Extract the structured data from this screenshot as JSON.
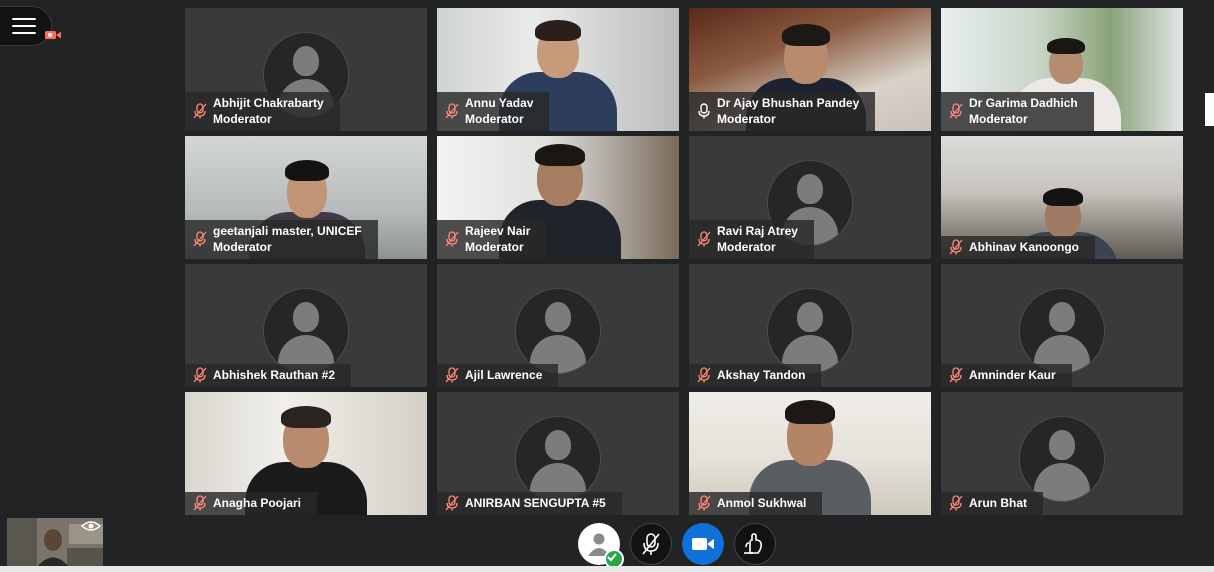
{
  "app": {
    "accent": "#0f70d7",
    "active_speaker_border": "#e8857c"
  },
  "participants": [
    {
      "name": "Abhijit Chakrabarty",
      "role": "Moderator",
      "video": false,
      "mic": "muted"
    },
    {
      "name": "Annu Yadav",
      "role": "Moderator",
      "video": true,
      "mic": "muted"
    },
    {
      "name": "Dr Ajay Bhushan Pandey",
      "role": "Moderator",
      "video": true,
      "mic": "talking",
      "active": true
    },
    {
      "name": "Dr Garima Dadhich",
      "role": "Moderator",
      "video": true,
      "mic": "muted"
    },
    {
      "name": "geetanjali master, UNICEF",
      "role": "Moderator",
      "video": true,
      "mic": "muted"
    },
    {
      "name": "Rajeev Nair",
      "role": "Moderator",
      "video": true,
      "mic": "muted"
    },
    {
      "name": "Ravi Raj Atrey",
      "role": "Moderator",
      "video": false,
      "mic": "muted"
    },
    {
      "name": "Abhinav Kanoongo",
      "role": "",
      "video": true,
      "mic": "muted"
    },
    {
      "name": "Abhishek Rauthan #2",
      "role": "",
      "video": false,
      "mic": "muted"
    },
    {
      "name": "Ajil Lawrence",
      "role": "",
      "video": false,
      "mic": "muted"
    },
    {
      "name": "Akshay Tandon",
      "role": "",
      "video": false,
      "mic": "muted"
    },
    {
      "name": "Amninder Kaur",
      "role": "",
      "video": false,
      "mic": "muted"
    },
    {
      "name": "Anagha Poojari",
      "role": "",
      "video": true,
      "mic": "muted"
    },
    {
      "name": "ANIRBAN SENGUPTA #5",
      "role": "",
      "video": false,
      "mic": "muted"
    },
    {
      "name": "Anmol Sukhwal",
      "role": "",
      "video": true,
      "mic": "muted"
    },
    {
      "name": "Arun Bhat",
      "role": "",
      "video": false,
      "mic": "muted"
    }
  ],
  "controls": {
    "user_status": {
      "icon": "user-icon",
      "badge": "check-icon"
    },
    "mic": {
      "icon": "mic-muted-icon"
    },
    "camera": {
      "icon": "video-camera-icon"
    },
    "share": {
      "icon": "raise-hand-icon"
    }
  },
  "icons": {
    "menu": "hamburger-icon",
    "recording": "recording-icon",
    "self_view": "eye-icon"
  }
}
